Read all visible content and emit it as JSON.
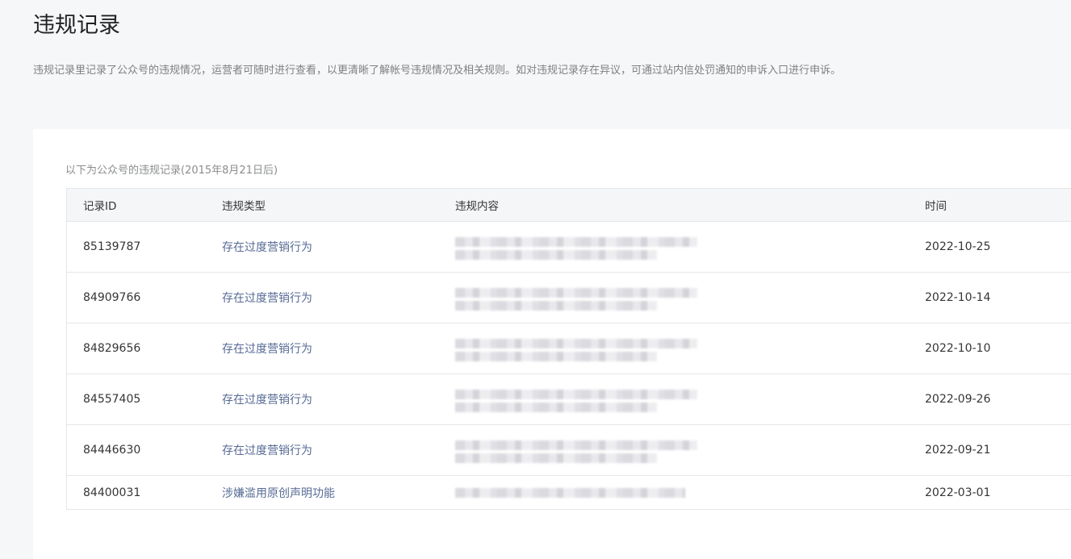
{
  "page": {
    "title": "违规记录",
    "description": "违规记录里记录了公众号的违规情况，运营者可随时进行查看，以更清晰了解帐号违规情况及相关规则。如对违规记录存在异议，可通过站内信处罚通知的申诉入口进行申诉。"
  },
  "records": {
    "caption": "以下为公众号的违规记录(2015年8月21日后)",
    "columns": {
      "id": "记录ID",
      "type": "违规类型",
      "content": "违规内容",
      "time": "时间"
    },
    "rows": [
      {
        "id": "85139787",
        "type": "存在过度营销行为",
        "time": "2022-10-25"
      },
      {
        "id": "84909766",
        "type": "存在过度营销行为",
        "time": "2022-10-14"
      },
      {
        "id": "84829656",
        "type": "存在过度营销行为",
        "time": "2022-10-10"
      },
      {
        "id": "84557405",
        "type": "存在过度营销行为",
        "time": "2022-09-26"
      },
      {
        "id": "84446630",
        "type": "存在过度营销行为",
        "time": "2022-09-21"
      },
      {
        "id": "84400031",
        "type": "涉嫌滥用原创声明功能",
        "time": "2022-03-01"
      }
    ]
  },
  "colors": {
    "link": "#576b95",
    "background": "#f6f7f9",
    "header_bg": "#f5f6f8"
  }
}
